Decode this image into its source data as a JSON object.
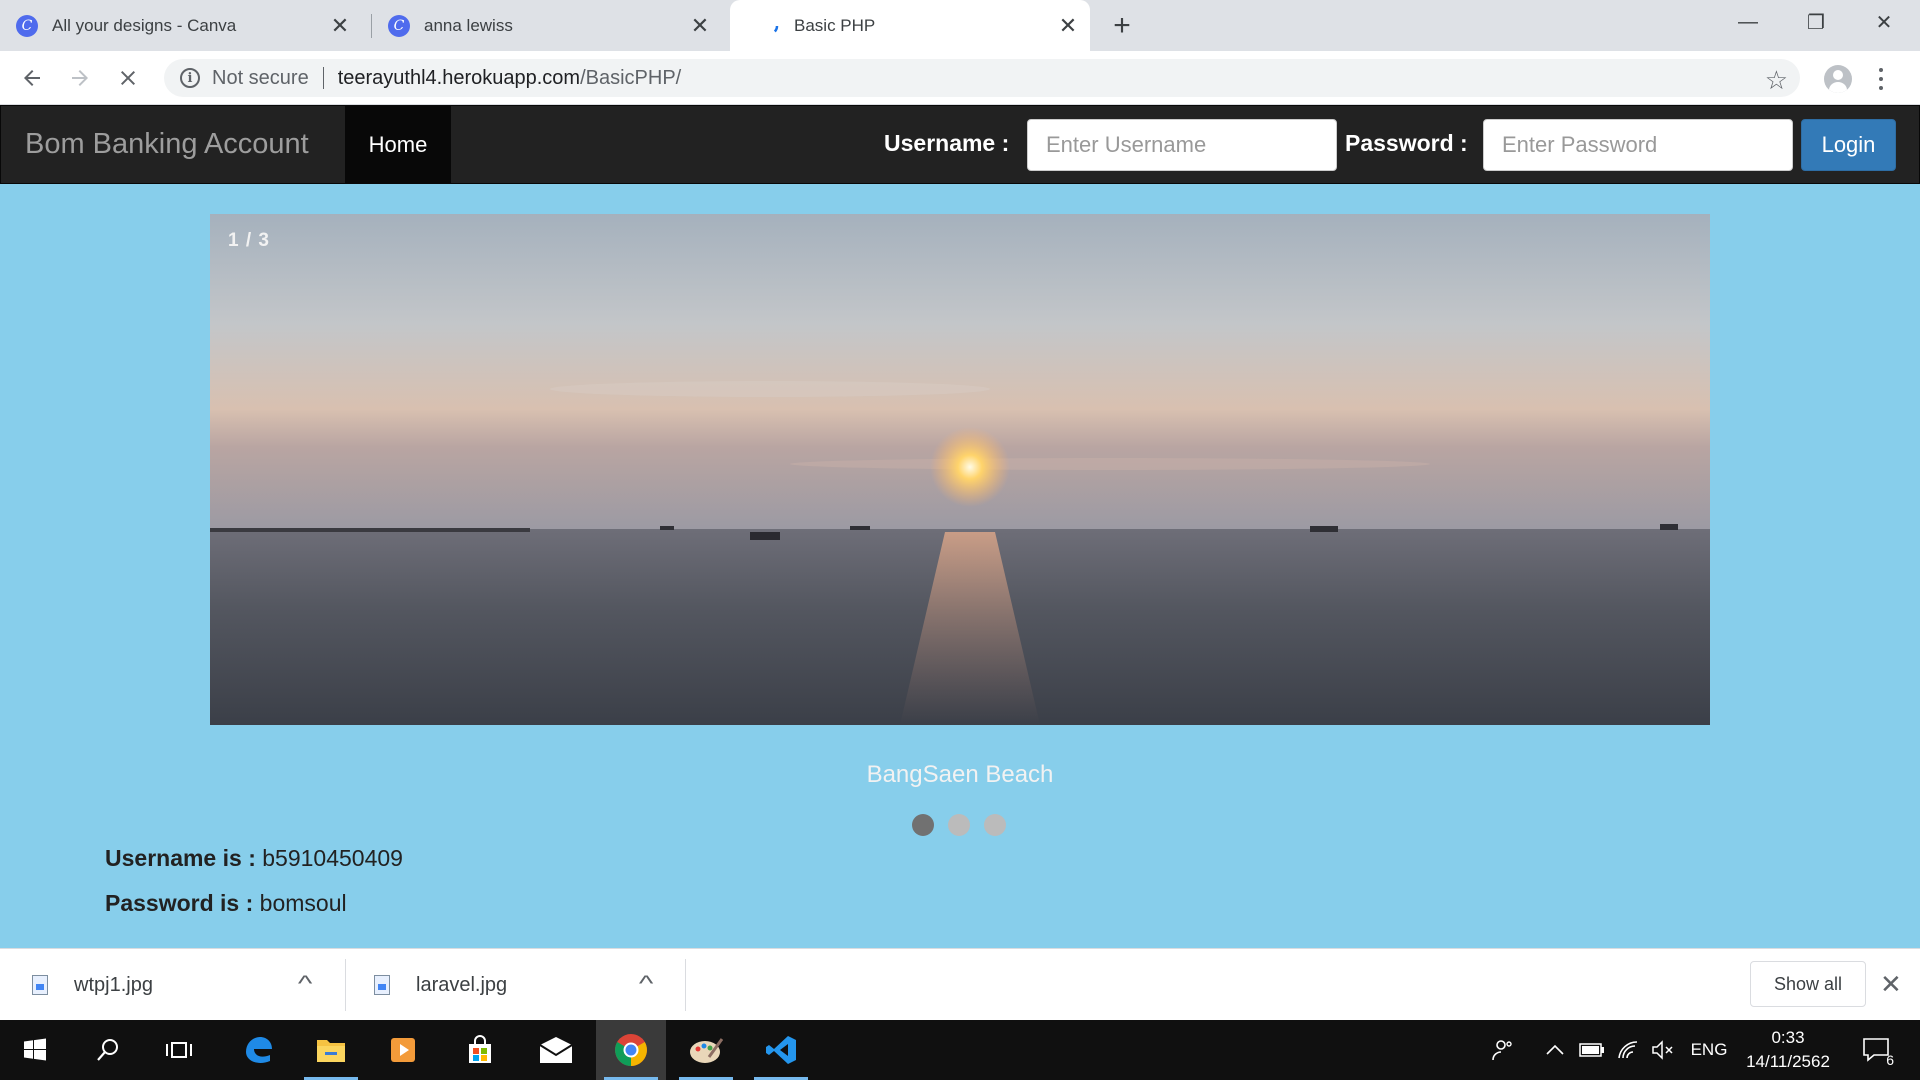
{
  "browser": {
    "tabs": [
      {
        "title": "All your designs - Canva",
        "favicon": "canva-icon",
        "active": false
      },
      {
        "title": "anna lewiss",
        "favicon": "canva-icon",
        "active": false
      },
      {
        "title": "Basic PHP",
        "favicon": "loading-icon",
        "active": true
      }
    ],
    "favicon_letter": "C",
    "close_glyph": "✕",
    "new_tab_glyph": "+",
    "window": {
      "minimize": "—",
      "restore": "❐",
      "close": "✕"
    },
    "security_label": "Not secure",
    "url_host": "teerayuthl4.herokuapp.com",
    "url_path": "/BasicPHP/",
    "icons": {
      "back": "🡐",
      "forward": "🡒",
      "stop": "✕",
      "star": "☆"
    }
  },
  "page": {
    "brand": "Bom Banking Account",
    "nav_home": "Home",
    "username_label": "Username :",
    "username_placeholder": "Enter Username",
    "password_label": "Password :",
    "password_placeholder": "Enter Password",
    "login_button": "Login",
    "slideshow": {
      "counter": "1 / 3",
      "caption": "BangSaen Beach",
      "current": 1,
      "total": 3
    },
    "info": {
      "username_label": "Username is :",
      "username_value": "b5910450409",
      "password_label": "Password is :",
      "password_value": "bomsoul"
    }
  },
  "downloads": {
    "items": [
      {
        "name": "wtpj1.jpg"
      },
      {
        "name": "laravel.jpg"
      }
    ],
    "show_all": "Show all",
    "close_glyph": "✕",
    "chevron_glyph": "^"
  },
  "taskbar": {
    "apps": [
      "windows-start-icon",
      "search-icon",
      "task-view-icon",
      "edge-icon",
      "file-explorer-icon",
      "media-player-icon",
      "store-icon",
      "mail-icon",
      "chrome-icon",
      "paint-icon",
      "vscode-icon"
    ],
    "tray": {
      "language": "ENG",
      "time": "0:33",
      "date": "14/11/2562",
      "notifications": "6"
    }
  },
  "colors": {
    "page_background": "#87ceeb",
    "navbar": "#222222",
    "login_button": "#337ab7",
    "dot_active": "#717171",
    "dot_inactive": "#bbbbbb"
  }
}
